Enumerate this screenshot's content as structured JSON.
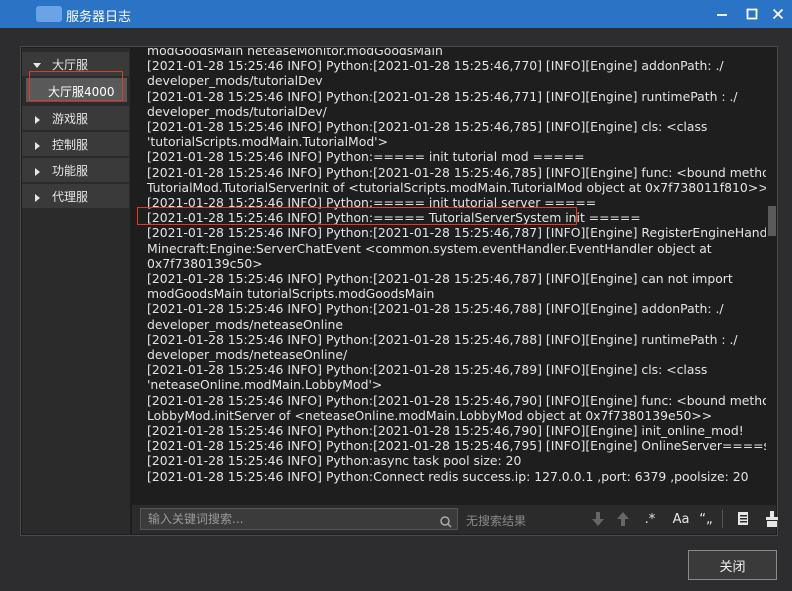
{
  "window": {
    "title": "服务器日志",
    "minimize_icon": "minimize-icon",
    "maximize_icon": "maximize-icon",
    "close_icon": "close-icon"
  },
  "sidebar": {
    "groups": [
      {
        "label": "大厅服",
        "expanded": true,
        "children": [
          "大厅服4000"
        ]
      },
      {
        "label": "游戏服",
        "expanded": false
      },
      {
        "label": "控制服",
        "expanded": false
      },
      {
        "label": "功能服",
        "expanded": false
      },
      {
        "label": "代理服",
        "expanded": false
      }
    ],
    "selected": "大厅服4000"
  },
  "log": {
    "lines": [
      "modGoodsMain neteaseMonitor.modGoodsMain",
      "[2021-01-28 15:25:46 INFO] Python:[2021-01-28 15:25:46,770] [INFO][Engine] addonPath:  ./",
      "developer_mods/tutorialDev",
      "[2021-01-28 15:25:46 INFO] Python:[2021-01-28 15:25:46,771] [INFO][Engine] runtimePath :  ./",
      "developer_mods/tutorialDev/",
      "[2021-01-28 15:25:46 INFO] Python:[2021-01-28 15:25:46,785] [INFO][Engine] cls:  <class",
      "'tutorialScripts.modMain.TutorialMod'>",
      "[2021-01-28 15:25:46 INFO] Python:===== init tutorial mod =====",
      "[2021-01-28 15:25:46 INFO] Python:[2021-01-28 15:25:46,785] [INFO][Engine] func:  <bound method",
      "TutorialMod.TutorialServerInit of <tutorialScripts.modMain.TutorialMod object at 0x7f738011f810>>",
      "[2021-01-28 15:25:46 INFO] Python:===== init tutorial server =====",
      "[2021-01-28 15:25:46 INFO] Python:===== TutorialServerSystem init =====",
      "[2021-01-28 15:25:46 INFO] Python:[2021-01-28 15:25:46,787] [INFO][Engine] RegisterEngineHandler:",
      "Minecraft:Engine:ServerChatEvent <common.system.eventHandler.EventHandler object at",
      "0x7f7380139c50>",
      "[2021-01-28 15:25:46 INFO] Python:[2021-01-28 15:25:46,787] [INFO][Engine] can not import",
      "modGoodsMain tutorialScripts.modGoodsMain",
      "[2021-01-28 15:25:46 INFO] Python:[2021-01-28 15:25:46,788] [INFO][Engine] addonPath:  ./",
      "developer_mods/neteaseOnline",
      "[2021-01-28 15:25:46 INFO] Python:[2021-01-28 15:25:46,788] [INFO][Engine] runtimePath :  ./",
      "developer_mods/neteaseOnline/",
      "[2021-01-28 15:25:46 INFO] Python:[2021-01-28 15:25:46,789] [INFO][Engine] cls:  <class",
      "'neteaseOnline.modMain.LobbyMod'>",
      "[2021-01-28 15:25:46 INFO] Python:[2021-01-28 15:25:46,790] [INFO][Engine] func:  <bound method",
      "LobbyMod.initServer of <neteaseOnline.modMain.LobbyMod object at 0x7f7380139e50>>",
      "[2021-01-28 15:25:46 INFO] Python:[2021-01-28 15:25:46,790] [INFO][Engine] init_online_mod!",
      "[2021-01-28 15:25:46 INFO] Python:[2021-01-28 15:25:46,795] [INFO][Engine] OnlineServer====start!!!!!",
      "[2021-01-28 15:25:46 INFO] Python:async task pool size: 20",
      "[2021-01-28 15:25:46 INFO] Python:Connect redis success.ip: 127.0.0.1 ,port: 6379 ,poolsize: 20"
    ],
    "highlighted_line": 10
  },
  "search": {
    "placeholder": "输入关键词搜索...",
    "value": "",
    "status": "无搜索结果",
    "regex_label": ".*",
    "case_label": "Aa",
    "word_label": "“„"
  },
  "footer": {
    "close_label": "关闭"
  }
}
